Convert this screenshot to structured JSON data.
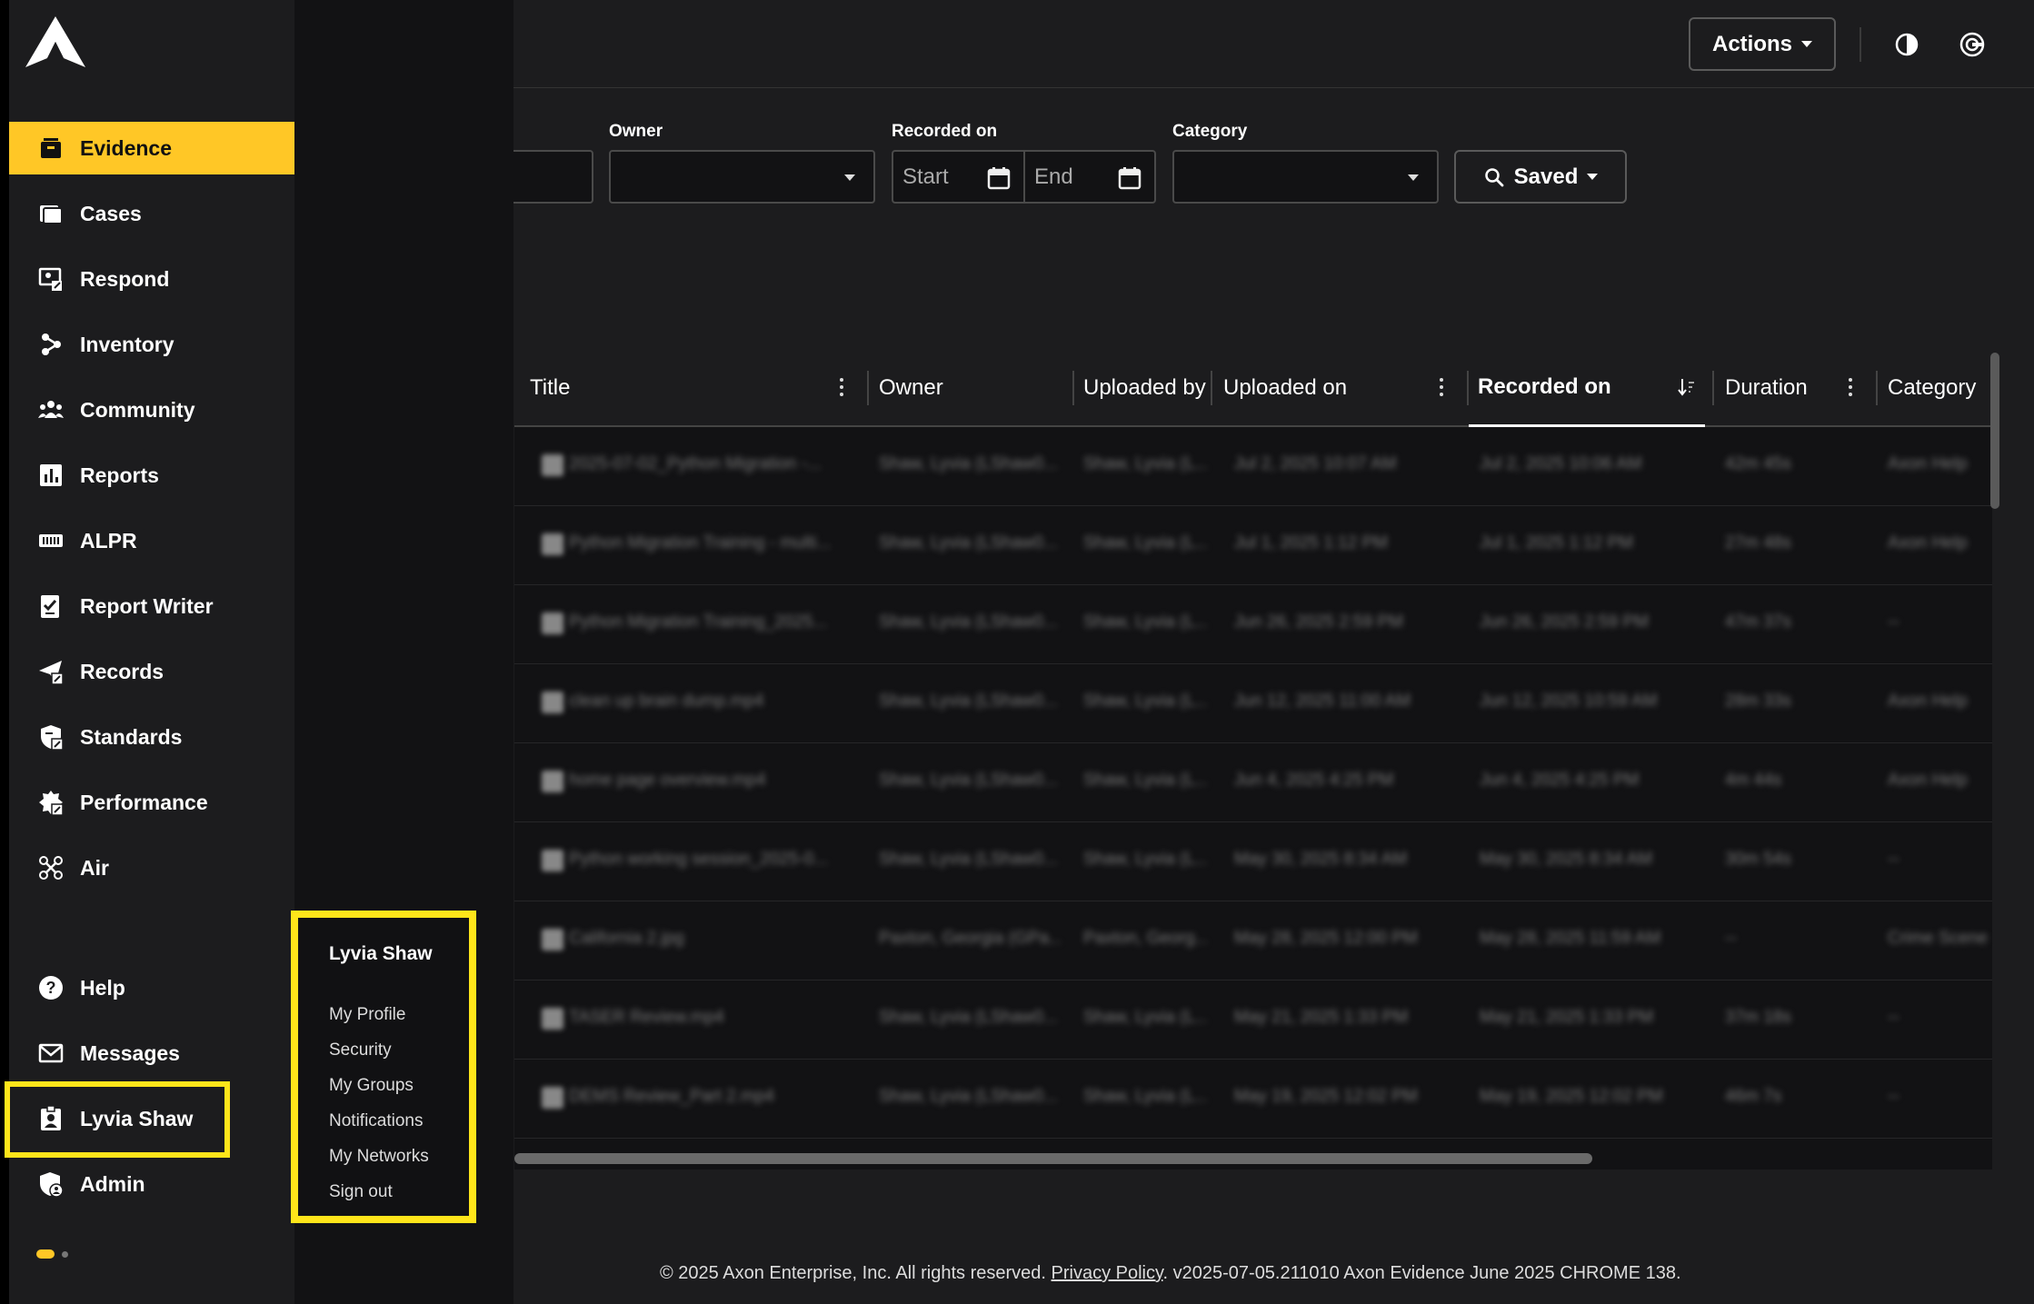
{
  "topbar": {
    "actions_label": "Actions",
    "contrast_icon": "contrast-icon",
    "account_icon": "axon-circle-icon"
  },
  "filters": {
    "owner_label": "Owner",
    "owner_value": "",
    "recorded_on_label": "Recorded on",
    "start_placeholder": "Start",
    "end_placeholder": "End",
    "category_label": "Category",
    "category_value": "",
    "saved_label": "Saved"
  },
  "table": {
    "columns": [
      "Title",
      "Owner",
      "Uploaded by",
      "Uploaded on",
      "Recorded on",
      "Duration",
      "Category"
    ],
    "sorted_column": "Recorded on",
    "rows": [
      {
        "title": "2025-07-02_Python Migration -...",
        "owner": "Shaw, Lyvia (LShaw0...",
        "uploaded_by": "Shaw, Lyvia (L...",
        "uploaded_on": "Jul 2, 2025 10:07 AM",
        "recorded_on": "Jul 2, 2025 10:06 AM",
        "duration": "42m 45s",
        "category": "Axon Help"
      },
      {
        "title": "Python Migration Training - multi...",
        "owner": "Shaw, Lyvia (LShaw0...",
        "uploaded_by": "Shaw, Lyvia (L...",
        "uploaded_on": "Jul 1, 2025 1:12 PM",
        "recorded_on": "Jul 1, 2025 1:12 PM",
        "duration": "27m 48s",
        "category": "Axon Help"
      },
      {
        "title": "Python Migration Training_2025...",
        "owner": "Shaw, Lyvia (LShaw0...",
        "uploaded_by": "Shaw, Lyvia (L...",
        "uploaded_on": "Jun 26, 2025 2:59 PM",
        "recorded_on": "Jun 26, 2025 2:59 PM",
        "duration": "47m 37s",
        "category": "--"
      },
      {
        "title": "clean up brain dump.mp4",
        "owner": "Shaw, Lyvia (LShaw0...",
        "uploaded_by": "Shaw, Lyvia (L...",
        "uploaded_on": "Jun 12, 2025 11:00 AM",
        "recorded_on": "Jun 12, 2025 10:59 AM",
        "duration": "28m 33s",
        "category": "Axon Help"
      },
      {
        "title": "home page overview.mp4",
        "owner": "Shaw, Lyvia (LShaw0...",
        "uploaded_by": "Shaw, Lyvia (L...",
        "uploaded_on": "Jun 4, 2025 4:25 PM",
        "recorded_on": "Jun 4, 2025 4:25 PM",
        "duration": "4m 44s",
        "category": "Axon Help"
      },
      {
        "title": "Python working session_2025-0...",
        "owner": "Shaw, Lyvia (LShaw0...",
        "uploaded_by": "Shaw, Lyvia (L...",
        "uploaded_on": "May 30, 2025 8:34 AM",
        "recorded_on": "May 30, 2025 8:34 AM",
        "duration": "30m 54s",
        "category": "--"
      },
      {
        "title": "California 2.jpg",
        "owner": "Paxton, Georgia (GPa...",
        "uploaded_by": "Paxton, Georg...",
        "uploaded_on": "May 28, 2025 12:00 PM",
        "recorded_on": "May 28, 2025 11:59 AM",
        "duration": "--",
        "category": "Crime Scene"
      },
      {
        "title": "TASER Review.mp4",
        "owner": "Shaw, Lyvia (LShaw0...",
        "uploaded_by": "Shaw, Lyvia (L...",
        "uploaded_on": "May 21, 2025 1:33 PM",
        "recorded_on": "May 21, 2025 1:33 PM",
        "duration": "37m 18s",
        "category": "--"
      },
      {
        "title": "DEMS Review_Part 2.mp4",
        "owner": "Shaw, Lyvia (LShaw0...",
        "uploaded_by": "Shaw, Lyvia (L...",
        "uploaded_on": "May 19, 2025 12:02 PM",
        "recorded_on": "May 19, 2025 12:02 PM",
        "duration": "46m 7s",
        "category": "--"
      }
    ]
  },
  "sidebar": {
    "logo_icon": "axon-logo-icon",
    "items": [
      {
        "label": "Evidence",
        "icon": "evidence-icon"
      },
      {
        "label": "Cases",
        "icon": "cases-icon"
      },
      {
        "label": "Respond",
        "icon": "respond-icon"
      },
      {
        "label": "Inventory",
        "icon": "inventory-icon"
      },
      {
        "label": "Community",
        "icon": "community-icon"
      },
      {
        "label": "Reports",
        "icon": "reports-icon"
      },
      {
        "label": "ALPR",
        "icon": "alpr-icon"
      },
      {
        "label": "Report Writer",
        "icon": "report-writer-icon"
      },
      {
        "label": "Records",
        "icon": "records-icon"
      },
      {
        "label": "Standards",
        "icon": "standards-icon"
      },
      {
        "label": "Performance",
        "icon": "performance-icon"
      },
      {
        "label": "Air",
        "icon": "air-drone-icon"
      }
    ],
    "bottom_items": [
      {
        "label": "Help",
        "icon": "help-icon"
      },
      {
        "label": "Messages",
        "icon": "messages-icon"
      },
      {
        "label": "Lyvia Shaw",
        "icon": "user-badge-icon"
      },
      {
        "label": "Admin",
        "icon": "admin-icon"
      }
    ],
    "accent_color": "#ffc726"
  },
  "user_menu": {
    "title": "Lyvia Shaw",
    "items": [
      "My Profile",
      "Security",
      "My Groups",
      "Notifications",
      "My Networks",
      "Sign out"
    ]
  },
  "footer": {
    "prefix": "© 2025 Axon Enterprise, Inc. All rights reserved. ",
    "privacy_link": "Privacy Policy",
    "suffix": ". v2025-07-05.211010 Axon Evidence June 2025 CHROME 138."
  }
}
